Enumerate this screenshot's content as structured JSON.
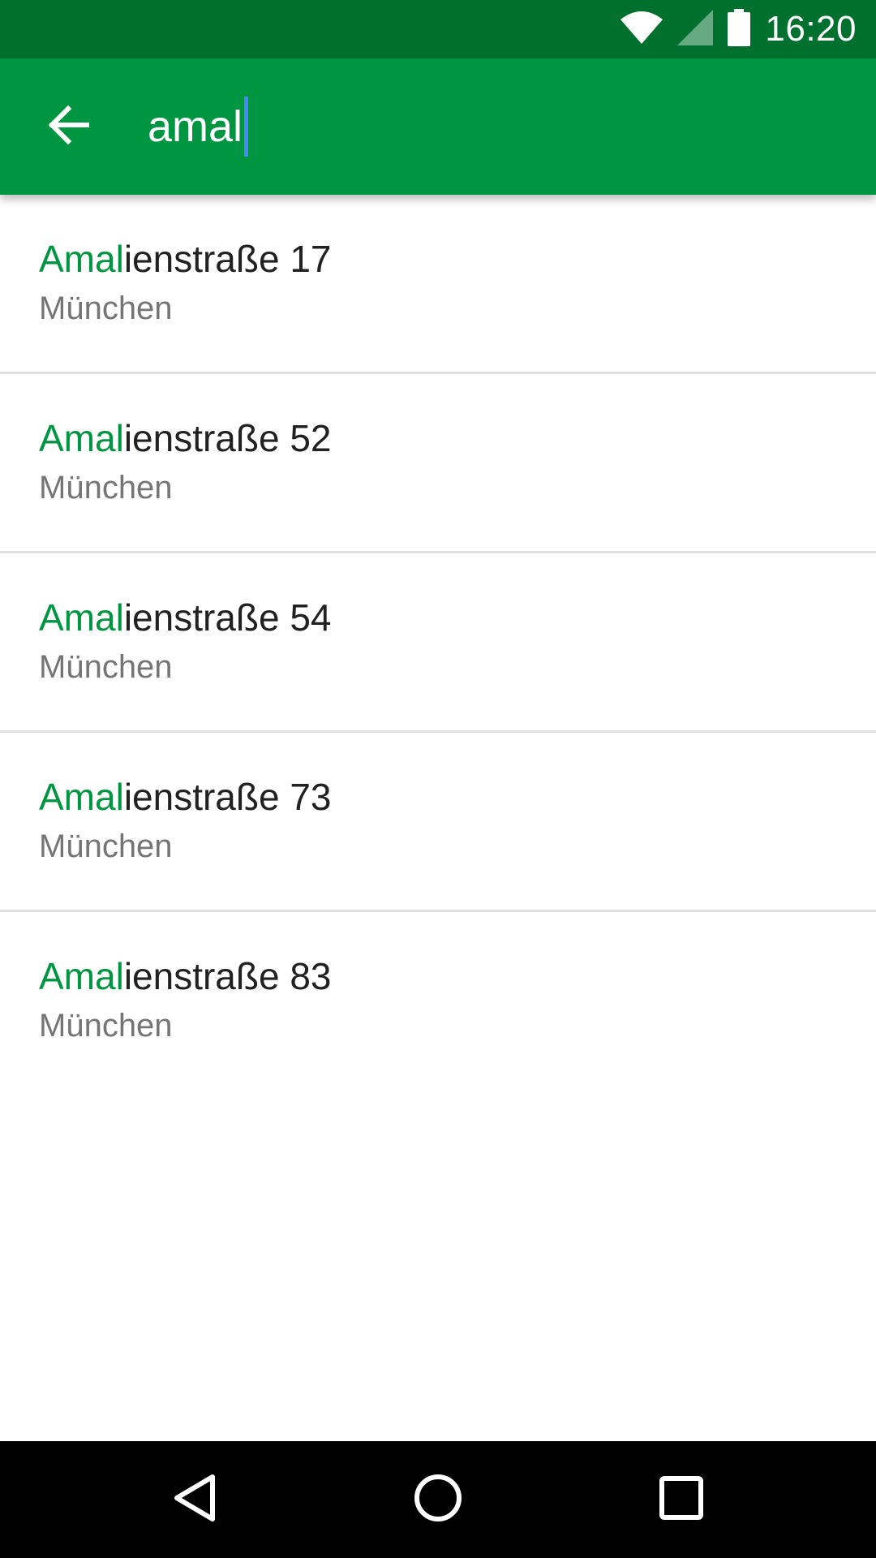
{
  "status_bar": {
    "time": "16:20",
    "icons": [
      "wifi-icon",
      "cell-signal-icon",
      "battery-icon"
    ]
  },
  "search": {
    "query": "amal",
    "back_icon": "arrow-back-icon"
  },
  "results": [
    {
      "match": "Amal",
      "rest": "ienstraße 17",
      "city": "München"
    },
    {
      "match": "Amal",
      "rest": "ienstraße 52",
      "city": "München"
    },
    {
      "match": "Amal",
      "rest": "ienstraße 54",
      "city": "München"
    },
    {
      "match": "Amal",
      "rest": "ienstraße 73",
      "city": "München"
    },
    {
      "match": "Amal",
      "rest": "ienstraße 83",
      "city": "München"
    }
  ],
  "nav_bar": {
    "icons": [
      "back-triangle-icon",
      "home-circle-icon",
      "recents-square-icon"
    ]
  },
  "colors": {
    "status_bar": "#00702f",
    "app_bar": "#009540",
    "highlight": "#009540",
    "caret": "#4a86ff"
  }
}
